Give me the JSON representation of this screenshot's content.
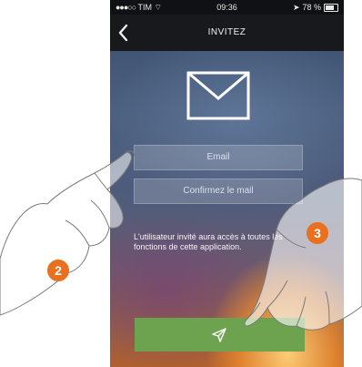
{
  "status_bar": {
    "carrier": "TIM",
    "time": "09:36",
    "battery": "78 %"
  },
  "nav": {
    "title": "INVITEZ"
  },
  "form": {
    "email_placeholder": "Email",
    "confirm_placeholder": "Confirmez le mail"
  },
  "info_text": "L'utilisateur invité aura accès à toutes les fonctions de cette application.",
  "send_button": {
    "icon": "send-icon"
  },
  "callouts": [
    {
      "number": "2"
    },
    {
      "number": "3"
    }
  ],
  "colors": {
    "accent_green": "#6da24e",
    "callout_orange": "#e8701f"
  }
}
